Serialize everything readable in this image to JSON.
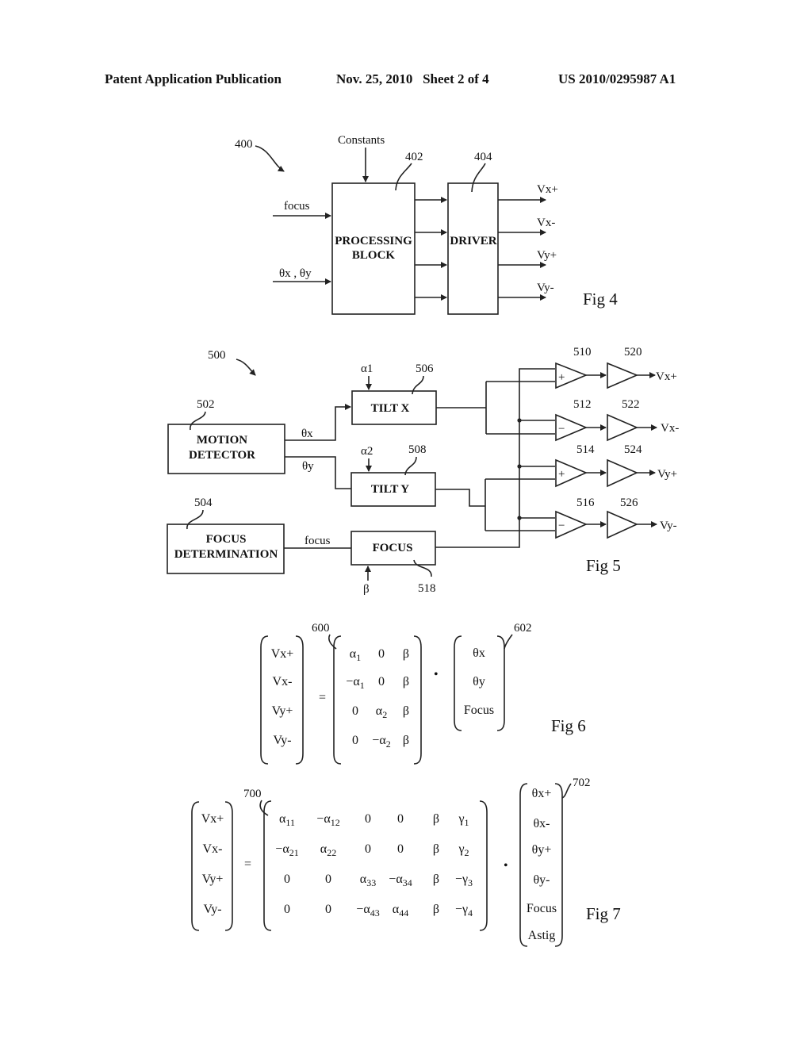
{
  "header": {
    "left": "Patent Application Publication",
    "date_sheet": "Nov. 25, 2010   Sheet 2 of 4",
    "number": "US 2010/0295987 A1"
  },
  "fig4": {
    "caption": "Fig 4",
    "ref": "400",
    "constants_label": "Constants",
    "inputs": [
      "focus",
      "θx , θy"
    ],
    "processing": {
      "ref": "402",
      "line1": "PROCESSING",
      "line2": "BLOCK"
    },
    "driver": {
      "ref": "404",
      "label": "DRIVER"
    },
    "outputs": [
      "Vx+",
      "Vx-",
      "Vy+",
      "Vy-"
    ]
  },
  "fig5": {
    "caption": "Fig 5",
    "ref": "500",
    "motion_detector": {
      "ref": "502",
      "line1": "MOTION",
      "line2": "DETECTOR"
    },
    "focus_determination": {
      "ref": "504",
      "line1": "FOCUS",
      "line2": "DETERMINATION"
    },
    "tilt_x": {
      "ref": "506",
      "label": "TILT X",
      "param": "α1"
    },
    "tilt_y": {
      "ref": "508",
      "label": "TILT Y",
      "param": "α2"
    },
    "focus_block": {
      "ref": "518",
      "label": "FOCUS",
      "param": "β"
    },
    "signals": {
      "theta_x": "θx",
      "theta_y": "θy",
      "focus": "focus"
    },
    "summers": [
      {
        "ref": "510",
        "sign": "+"
      },
      {
        "ref": "512",
        "sign": "−"
      },
      {
        "ref": "514",
        "sign": "+"
      },
      {
        "ref": "516",
        "sign": "−"
      }
    ],
    "amplifiers": [
      {
        "ref": "520",
        "output": "Vx+"
      },
      {
        "ref": "522",
        "output": "Vx-"
      },
      {
        "ref": "524",
        "output": "Vy+"
      },
      {
        "ref": "526",
        "output": "Vy-"
      }
    ]
  },
  "fig6": {
    "caption": "Fig 6",
    "matrix_ref": "600",
    "vector_ref": "602",
    "lhs": [
      "Vx+",
      "Vx-",
      "Vy+",
      "Vy-"
    ],
    "equals": "=",
    "dot": "•",
    "matrix": [
      [
        "α1",
        "0",
        "β"
      ],
      [
        "−α1",
        "0",
        "β"
      ],
      [
        "0",
        "α2",
        "β"
      ],
      [
        "0",
        "−α2",
        "β"
      ]
    ],
    "vector": [
      "θx",
      "θy",
      "Focus"
    ]
  },
  "fig7": {
    "caption": "Fig 7",
    "matrix_ref": "700",
    "vector_ref": "702",
    "lhs": [
      "Vx+",
      "Vx-",
      "Vy+",
      "Vy-"
    ],
    "equals": "=",
    "dot": "•",
    "matrix": [
      [
        "α11",
        "−α12",
        "0",
        "0",
        "β",
        "γ1"
      ],
      [
        "−α21",
        "α22",
        "0",
        "0",
        "β",
        "γ2"
      ],
      [
        "0",
        "0",
        "α33",
        "−α34",
        "β",
        "−γ3"
      ],
      [
        "0",
        "0",
        "−α43",
        "α44",
        "β",
        "−γ4"
      ]
    ],
    "vector": [
      "θx+",
      "θx-",
      "θy+",
      "θy-",
      "Focus",
      "Astig"
    ]
  }
}
